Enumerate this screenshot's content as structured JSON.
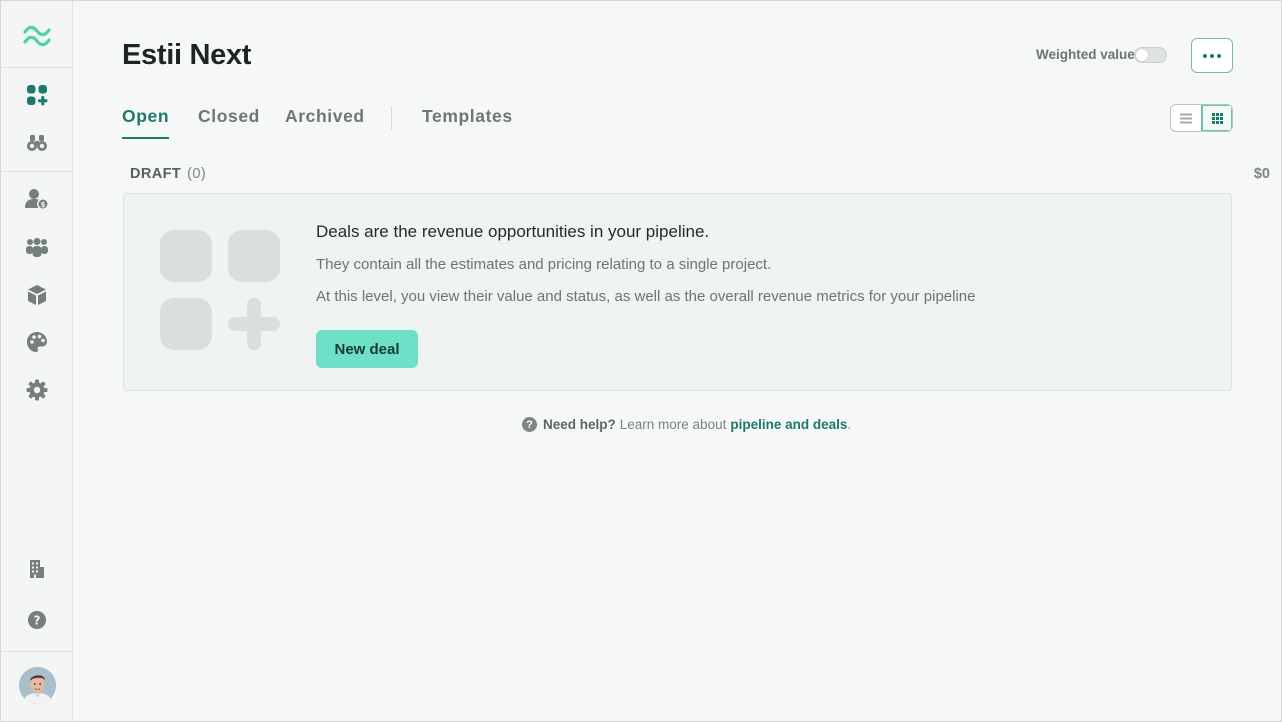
{
  "sidebar": {
    "icons": [
      "logo-waves-icon",
      "deals-icon",
      "binoculars-icon",
      "user-dollar-icon",
      "team-icon",
      "box-icon",
      "palette-icon",
      "gear-icon",
      "building-icon",
      "help-icon"
    ],
    "accent": "#1b7a6b",
    "logo_color": "#4fd1a5"
  },
  "header": {
    "title": "Estii Next",
    "weighted_label": "Weighted value",
    "weighted_on": false
  },
  "tabs": {
    "items": [
      {
        "label": "Open",
        "active": true
      },
      {
        "label": "Closed",
        "active": false
      },
      {
        "label": "Archived",
        "active": false
      },
      {
        "label": "Templates",
        "active": false
      }
    ]
  },
  "view_toggle": {
    "selected": "grid"
  },
  "section": {
    "name": "DRAFT",
    "count": "(0)",
    "total": "$0"
  },
  "empty_state": {
    "title": "Deals are the revenue opportunities in your pipeline.",
    "line1": "They contain all the estimates and pricing relating to a single project.",
    "line2": "At this level, you view their value and status, as well as the overall revenue metrics for your pipeline",
    "button_label": "New deal",
    "button_color": "#6fe0c8"
  },
  "help": {
    "lead": "Need help?",
    "text": "Learn more about",
    "link": "pipeline and deals",
    "end": "."
  }
}
